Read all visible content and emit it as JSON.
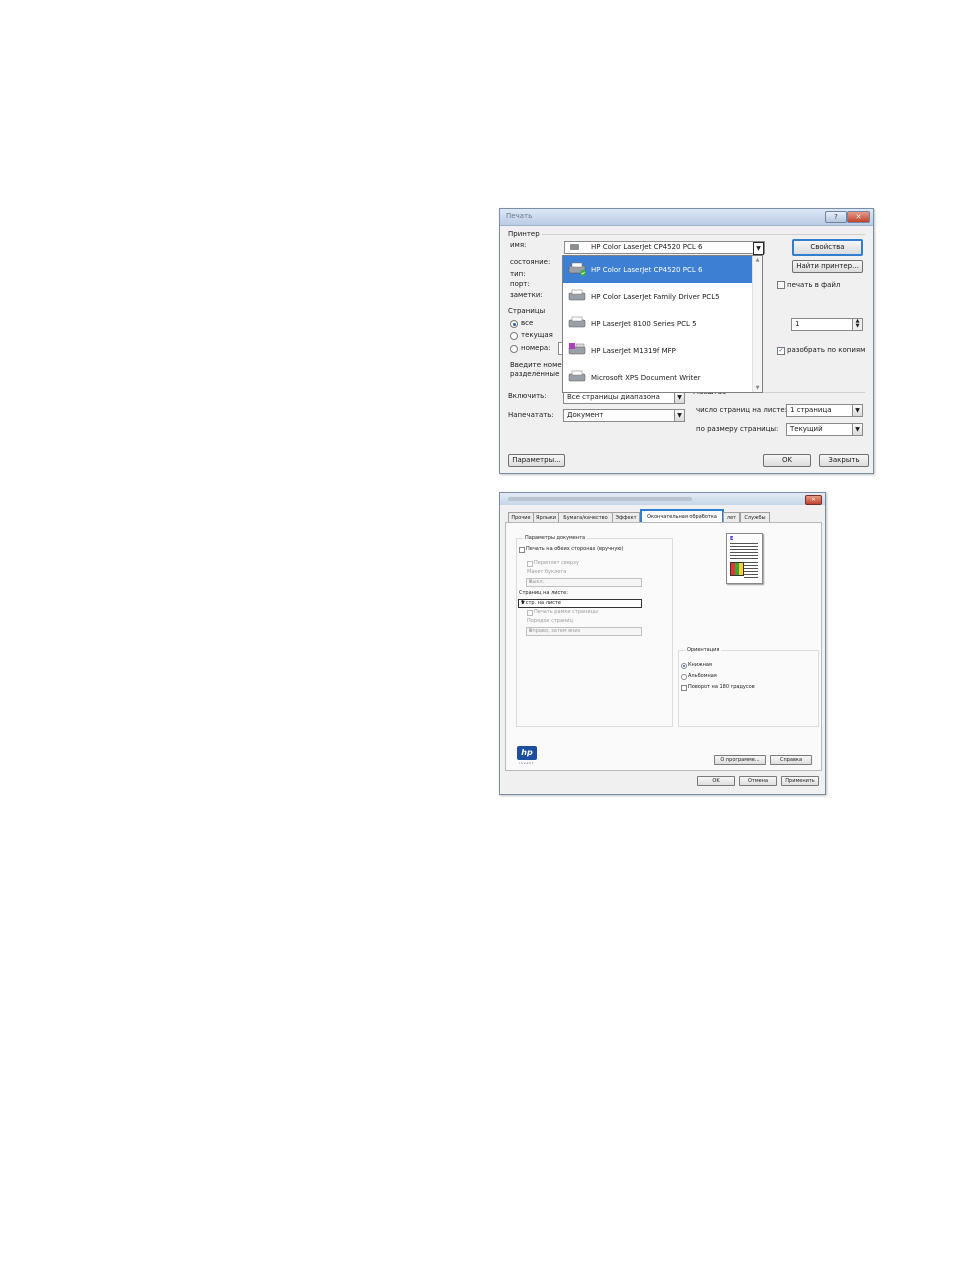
{
  "print_dialog": {
    "title": "Печать",
    "help_label": "?",
    "close_label": "✕",
    "printer_group": "Принтер",
    "name_label": "имя:",
    "selected_printer": "HP Color LaserJet CP4520 PCL 6",
    "status_label": "состояние:",
    "type_label": "тип:",
    "port_label": "порт:",
    "notes_label": "заметки:",
    "properties_button": "Свойства",
    "find_printer_button": "Найти принтер...",
    "print_to_file_label": "печать в файл",
    "pages_group": "Страницы",
    "all_label": "все",
    "current_label": "текущая",
    "numbers_label": "номера:",
    "hint_line1": "Введите номер",
    "hint_line2": "разделенные з",
    "copies_value": "1",
    "collate_label": "разобрать по копиям",
    "include_label": "Включить:",
    "include_value": "Все страницы диапазона",
    "print_label": "Напечатать:",
    "print_value": "Документ",
    "scale_group": "Масштаб",
    "pages_per_sheet_label": "число страниц на листе:",
    "pages_per_sheet_value": "1 страница",
    "fit_label": "по размеру страницы:",
    "fit_value": "Текущий",
    "options_button": "Параметры...",
    "ok_button": "OK",
    "close_button": "Закрыть",
    "printer_list": [
      {
        "name": "HP Color LaserJet CP4520 PCL 6",
        "icon": "printer-default-icon",
        "selected": true
      },
      {
        "name": "HP Color LaserJet Family Driver PCL5",
        "icon": "printer-icon",
        "selected": false
      },
      {
        "name": "HP LaserJet 8100 Series PCL 5",
        "icon": "printer-icon",
        "selected": false
      },
      {
        "name": "HP LaserJet M1319f MFP",
        "icon": "mfp-icon",
        "selected": false
      },
      {
        "name": "Microsoft XPS Document Writer",
        "icon": "printer-icon",
        "selected": false
      }
    ],
    "colors": {
      "selection": "#3d7fd2",
      "focus": "#2f7fd0"
    }
  },
  "props_dialog": {
    "close_label": "✕",
    "tabs": [
      {
        "label": "Прочие",
        "active": false
      },
      {
        "label": "Ярлыки",
        "active": false
      },
      {
        "label": "Бумага/качество",
        "active": false
      },
      {
        "label": "Эффект",
        "active": false
      },
      {
        "label": "Окончательная обработка",
        "active": true
      },
      {
        "label": "лет",
        "active": false
      },
      {
        "label": "Службы",
        "active": false
      }
    ],
    "doc_options_group": "Параметры документа",
    "duplex_label": "Печать на обеих сторонах (вручную)",
    "flip_label": "Переплет сверху",
    "booklet_label": "Макет буклета",
    "booklet_value": "Выкл.",
    "pps_label": "Страниц на листе:",
    "pps_value": "1 стр. на листе",
    "borders_label": "Печать рамки страницы",
    "order_label": "Порядок страниц",
    "order_value": "Вправо, затем вниз",
    "orientation_group": "Ориентация",
    "portrait_label": "Книжная",
    "landscape_label": "Альбомная",
    "rotate_label": "Поворот на 180 градусов",
    "logo_text": "hp",
    "logo_sub": "invent",
    "about_button": "О программе...",
    "help_button": "Справка",
    "ok_button": "OK",
    "cancel_button": "Отмена",
    "apply_button": "Применить"
  }
}
